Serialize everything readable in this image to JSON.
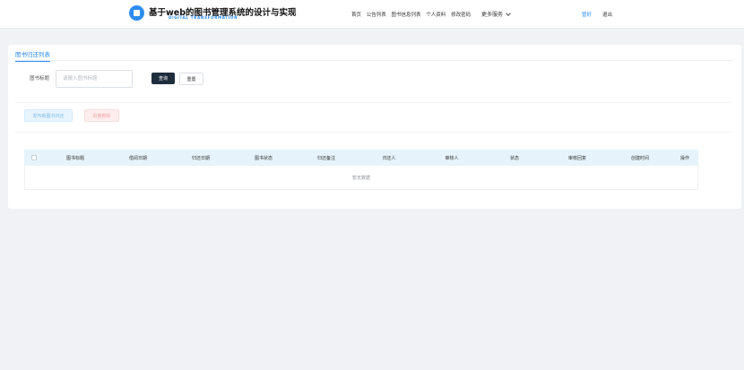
{
  "header": {
    "title": "基于web的图书管理系统的设计与实现",
    "subtitle": "DIGITAL TRANSFORMATION",
    "nav": [
      "首页",
      "公告列表",
      "图书信息列表",
      "个人资料",
      "修改密码"
    ],
    "more": "更多服务",
    "user": "管好",
    "logout": "退出",
    "accent": "#2d8cf0"
  },
  "page": {
    "tab": "图书归还列表",
    "search": {
      "label": "图书标题",
      "placeholder": "请输入图书标题",
      "search_label": "查询",
      "reset_label": "重置"
    },
    "actions": {
      "add_label": "发布新图书归还",
      "delete_label": "批量删除"
    },
    "table": {
      "columns": [
        "图书标题",
        "借阅日期",
        "归还日期",
        "图书状态",
        "归还备注",
        "归还人",
        "审核人",
        "状态",
        "审核回复",
        "创建时间",
        "操作"
      ],
      "rows": [],
      "empty_text": "暂无数据"
    }
  }
}
